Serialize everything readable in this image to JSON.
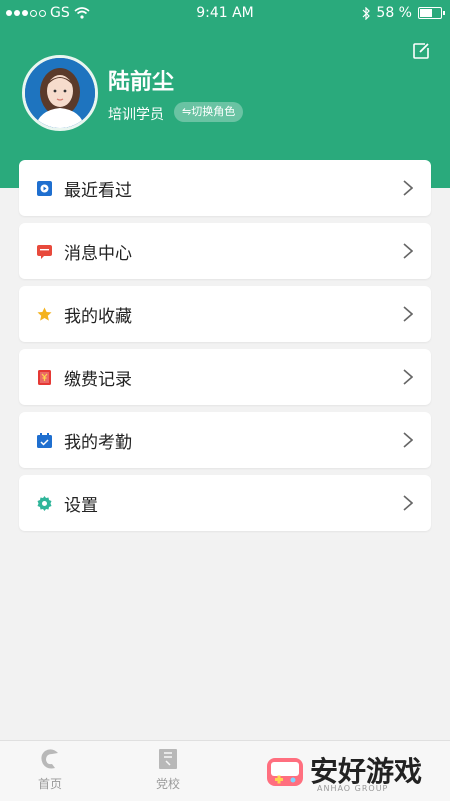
{
  "status_bar": {
    "carrier": "GS",
    "time": "9:41 AM",
    "battery_percent": "58 %",
    "battery_level": 0.58
  },
  "profile": {
    "name": "陆前尘",
    "role": "培训学员",
    "switch_role_label": "⇋切换角色",
    "edit_icon": "edit-icon"
  },
  "menu": [
    {
      "label": "最近看过",
      "icon": "recent-play-icon",
      "color": "#1f6fcf"
    },
    {
      "label": "消息中心",
      "icon": "message-icon",
      "color": "#e84a3c"
    },
    {
      "label": "我的收藏",
      "icon": "star-icon",
      "color": "#f4b21c"
    },
    {
      "label": "缴费记录",
      "icon": "receipt-icon",
      "color": "#e53935"
    },
    {
      "label": "我的考勤",
      "icon": "calendar-icon",
      "color": "#1f6fcf"
    },
    {
      "label": "设置",
      "icon": "gear-icon",
      "color": "#2fb59a"
    }
  ],
  "tabbar": [
    {
      "label": "首页",
      "icon": "home-icon"
    },
    {
      "label": "党校",
      "icon": "school-icon"
    }
  ],
  "watermark": {
    "text": "安好游戏",
    "sub": "ANHAO GROUP"
  },
  "colors": {
    "brand_green": "#2aaa7c"
  }
}
